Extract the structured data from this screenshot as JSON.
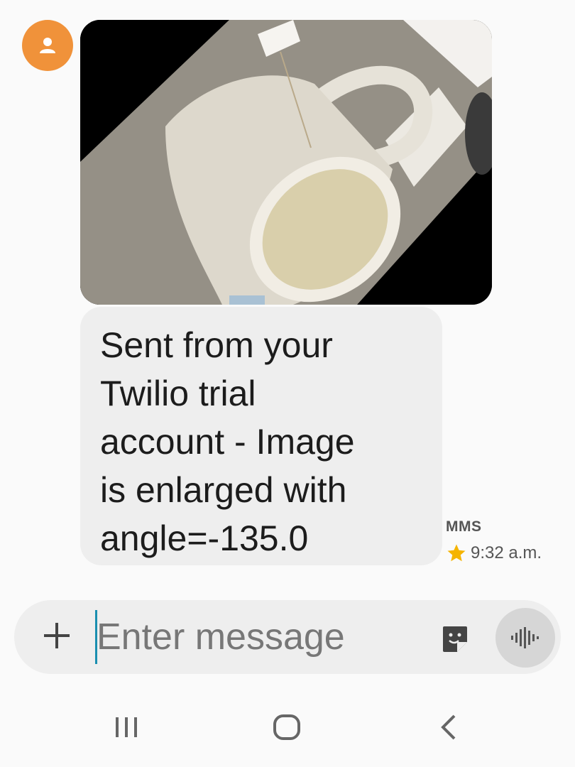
{
  "message": {
    "text": "Sent from your\nTwilio trial\naccount - Image\nis enlarged with\nangle=-135.0",
    "type_label": "MMS",
    "time": "9:32 a.m."
  },
  "composer": {
    "placeholder": "Enter message"
  },
  "colors": {
    "avatar": "#f0923a",
    "bubble": "#eeeeee",
    "accent_caret": "#1a8fb0",
    "star": "#f5b400"
  },
  "icons": {
    "avatar": "person-icon",
    "favorite": "star-icon",
    "attach": "plus-icon",
    "sticker": "sticker-icon",
    "voice": "voice-waveform-icon",
    "recents": "recent-apps-icon",
    "home": "home-icon",
    "back": "back-icon"
  }
}
